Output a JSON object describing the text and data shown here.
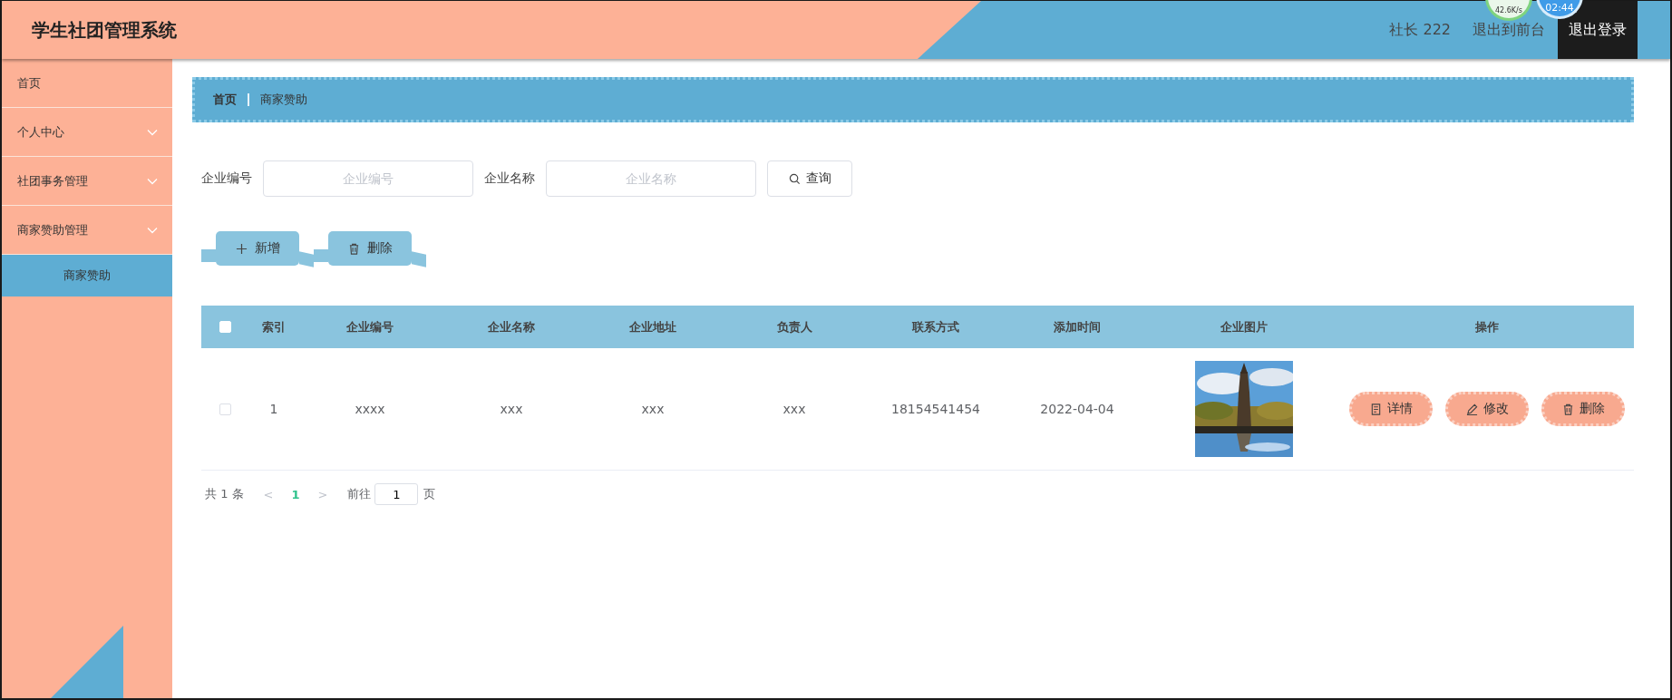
{
  "header": {
    "title": "学生社团管理系统",
    "user": "社长 222",
    "links": [
      {
        "label": "退出到前台",
        "kind": "plain"
      },
      {
        "label": "退出登录",
        "kind": "dark"
      }
    ]
  },
  "overlay_widget": {
    "speed": "42.6K/s",
    "time": "02:44"
  },
  "sidebar": {
    "items": [
      {
        "label": "首页",
        "kind": "link"
      },
      {
        "label": "个人中心",
        "kind": "submenu"
      },
      {
        "label": "社团事务管理",
        "kind": "submenu"
      },
      {
        "label": "商家赞助管理",
        "kind": "submenu",
        "children": [
          {
            "label": "商家赞助",
            "selected": true
          }
        ]
      }
    ]
  },
  "breadcrumb": [
    "首页",
    "商家赞助"
  ],
  "search": {
    "fields": [
      {
        "label": "企业编号",
        "placeholder": "企业编号"
      },
      {
        "label": "企业名称",
        "placeholder": "企业名称"
      }
    ],
    "button": "查询"
  },
  "actions": [
    {
      "label": "新增",
      "kind": "add"
    },
    {
      "label": "删除",
      "kind": "delete"
    }
  ],
  "table": {
    "all_checked": false,
    "columns": [
      "索引",
      "企业编号",
      "企业名称",
      "企业地址",
      "负责人",
      "联系方式",
      "添加时间",
      "企业图片",
      "操作"
    ],
    "rows": [
      {
        "checked": false,
        "cells": [
          "1",
          "xxxx",
          "xxx",
          "xxx",
          "xxx",
          "18154541454",
          "2022-04-04"
        ],
        "image": {
          "kind": "picture"
        },
        "buttons": [
          {
            "label": "详情",
            "kind": "detail"
          },
          {
            "label": "修改",
            "kind": "edit"
          },
          {
            "label": "删除",
            "kind": "delete"
          }
        ]
      }
    ]
  },
  "pagination": {
    "total": "共 1 条",
    "prev": "<",
    "pages": [
      {
        "label": "1",
        "selected": true
      }
    ],
    "next": ">",
    "goto": "前往",
    "page_value": "1",
    "page_suffix": "页"
  }
}
